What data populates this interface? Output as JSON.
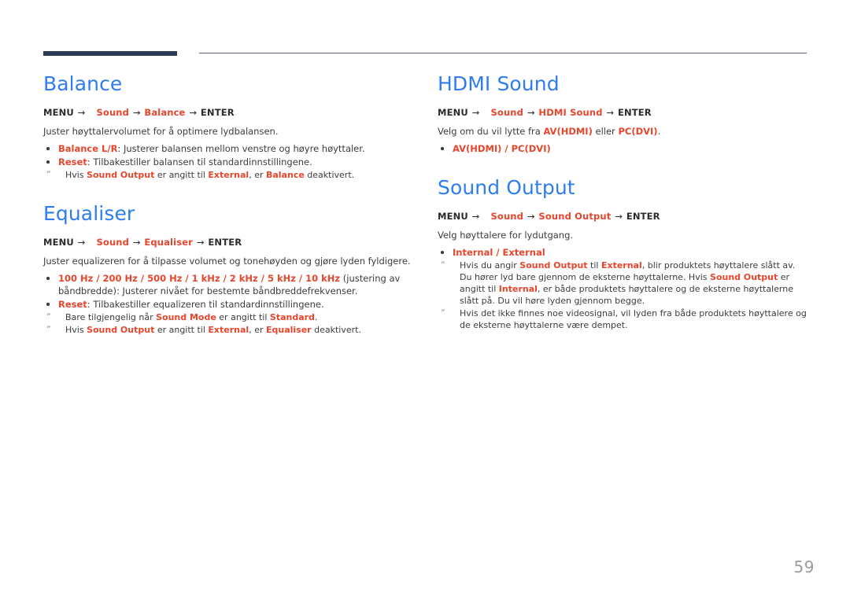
{
  "page": {
    "number": "59",
    "accent_heading_color": "#2e7df0",
    "accent_highlight_color": "#e8452c",
    "rule_color": "#2b3a55",
    "note_color": "#8d8d8d"
  },
  "arrow": "→",
  "note_marker": "ˮ",
  "left_column": {
    "sections": [
      {
        "heading": "Balance",
        "menu_prefix": "MENU",
        "menu_items": [
          "Sound",
          "Balance"
        ],
        "menu_suffix": "ENTER",
        "lead": "Juster høyttalervolumet for å optimere lydbalansen.",
        "bullets": [
          {
            "term": "Balance L/R",
            "rest": ": Justerer balansen mellom venstre og høyre høyttaler."
          },
          {
            "term": "Reset",
            "rest": ": Tilbakestiller balansen til standardinnstillingene."
          }
        ],
        "notes": [
          [
            {
              "t": "Hvis ",
              "hl": false
            },
            {
              "t": "Sound Output",
              "hl": true
            },
            {
              "t": " er angitt til ",
              "hl": false
            },
            {
              "t": "External",
              "hl": true
            },
            {
              "t": ", er ",
              "hl": false
            },
            {
              "t": "Balance",
              "hl": true
            },
            {
              "t": " deaktivert.",
              "hl": false
            }
          ]
        ]
      },
      {
        "heading": "Equaliser",
        "menu_prefix": "MENU",
        "menu_items": [
          "Sound",
          "Equaliser"
        ],
        "menu_suffix": "ENTER",
        "lead": "Juster equalizeren for å tilpasse volumet og tonehøyden og gjøre lyden fyldigere.",
        "bullets": [
          {
            "term": "100 Hz / 200 Hz / 500 Hz / 1 kHz / 2 kHz / 5 kHz / 10 kHz",
            "rest": " (justering av båndbredde): Justerer nivået for bestemte båndbreddefrekvenser."
          },
          {
            "term": "Reset",
            "rest": ": Tilbakestiller equalizeren til standardinnstillingene."
          }
        ],
        "notes": [
          [
            {
              "t": "Bare tilgjengelig når ",
              "hl": false
            },
            {
              "t": "Sound Mode",
              "hl": true
            },
            {
              "t": " er angitt til ",
              "hl": false
            },
            {
              "t": "Standard",
              "hl": true
            },
            {
              "t": ".",
              "hl": false
            }
          ],
          [
            {
              "t": "Hvis ",
              "hl": false
            },
            {
              "t": "Sound Output",
              "hl": true
            },
            {
              "t": " er angitt til ",
              "hl": false
            },
            {
              "t": "External",
              "hl": true
            },
            {
              "t": ", er ",
              "hl": false
            },
            {
              "t": "Equaliser",
              "hl": true
            },
            {
              "t": " deaktivert.",
              "hl": false
            }
          ]
        ]
      }
    ]
  },
  "right_column": {
    "sections": [
      {
        "heading": "HDMI Sound",
        "menu_prefix": "MENU",
        "menu_items": [
          "Sound",
          "HDMI Sound"
        ],
        "menu_suffix": "ENTER",
        "lead_parts": [
          {
            "t": "Velg om du vil lytte fra ",
            "hl": false
          },
          {
            "t": "AV(HDMI)",
            "hl": true
          },
          {
            "t": " eller ",
            "hl": false
          },
          {
            "t": "PC(DVI)",
            "hl": true
          },
          {
            "t": ".",
            "hl": false
          }
        ],
        "bullets": [
          {
            "term": "AV(HDMI) / PC(DVI)",
            "rest": ""
          }
        ],
        "notes": []
      },
      {
        "heading": "Sound Output",
        "menu_prefix": "MENU",
        "menu_items": [
          "Sound",
          "Sound Output"
        ],
        "menu_suffix": "ENTER",
        "lead": "Velg høyttalere for lydutgang.",
        "bullets": [
          {
            "term": "Internal / External",
            "rest": ""
          }
        ],
        "notes": [
          [
            {
              "t": "Hvis du angir ",
              "hl": false
            },
            {
              "t": "Sound Output",
              "hl": true
            },
            {
              "t": " til ",
              "hl": false
            },
            {
              "t": "External",
              "hl": true
            },
            {
              "t": ", blir produktets høyttalere slått av. Du hører lyd bare gjennom de eksterne høyttalerne. Hvis ",
              "hl": false
            },
            {
              "t": "Sound Output",
              "hl": true
            },
            {
              "t": " er angitt til ",
              "hl": false
            },
            {
              "t": "Internal",
              "hl": true
            },
            {
              "t": ", er både produktets høyttalere og de eksterne høyttalerne slått på. Du vil høre lyden gjennom begge.",
              "hl": false
            }
          ],
          [
            {
              "t": "Hvis det ikke finnes noe videosignal, vil lyden fra både produktets høyttalere og de eksterne høyttalerne være dempet.",
              "hl": false
            }
          ]
        ]
      }
    ]
  }
}
